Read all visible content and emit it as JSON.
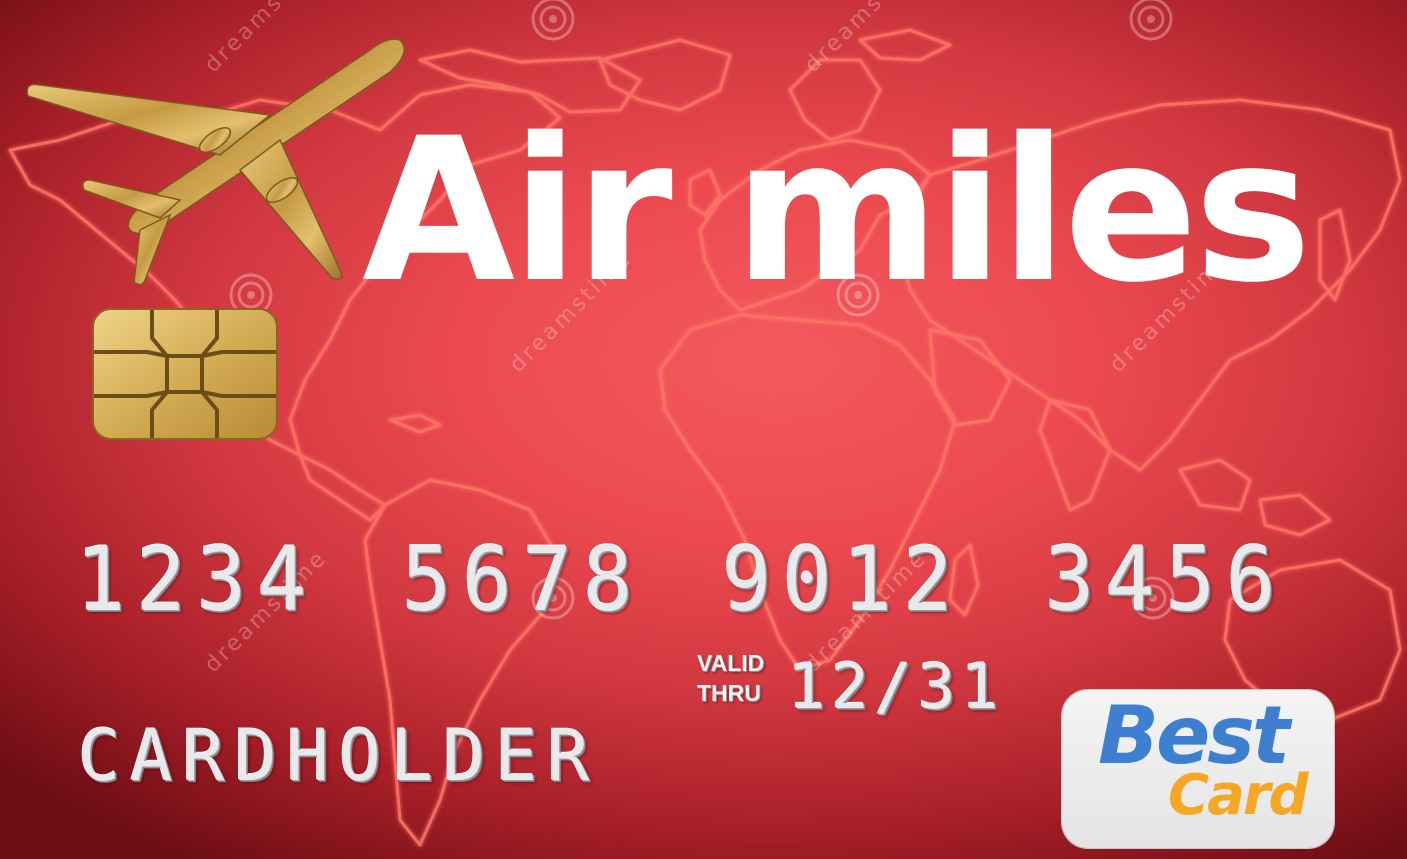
{
  "card": {
    "title": "Air miles",
    "number_groups": [
      "1234",
      "5678",
      "9012",
      "3456"
    ],
    "valid_label_line1": "VALID",
    "valid_label_line2": "THRU",
    "expiry": "12/31",
    "cardholder": "CARDHOLDER",
    "brand": {
      "line1": "Best",
      "line2": "Card",
      "line1_color": "#3f7fd0",
      "line2_color": "#f5a623"
    }
  },
  "watermark": {
    "text": "dreamstime"
  },
  "colors": {
    "card_red": "#ec4a50",
    "card_dark_red": "#6d0d14",
    "map_outline": "#ff6b5e",
    "plane_gold": "#c9a24a",
    "chip_gold": "#d9b45a"
  },
  "icons": [
    "airplane-icon",
    "chip-icon",
    "world-map",
    "watermark-swirl-icon"
  ]
}
